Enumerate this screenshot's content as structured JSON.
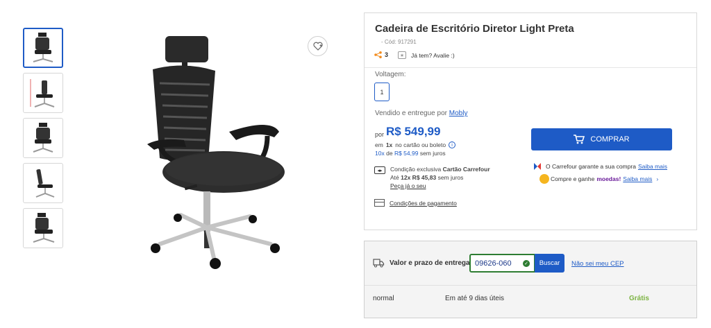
{
  "gallery": {
    "thumbnails": [
      "chair-front",
      "chair-side-dimensions",
      "chair-front-2",
      "chair-side",
      "chair-angle"
    ],
    "favorite_icon": "heart-plus-icon"
  },
  "product": {
    "title": "Cadeira de Escritório Diretor Light Preta",
    "sku": "- Cód: 917291",
    "share_count": "3",
    "review_prompt": "Já tem? Avalie :)",
    "voltage_label": "Voltagem:",
    "voltage_option": "1",
    "seller_prefix": "Vendido e entregue por",
    "seller_name": "Mobly",
    "price_prefix": "por",
    "price": "R$ 549,99",
    "install_em": "em",
    "install_1x": "1x",
    "install_1x_text": "no cartão ou boleto",
    "install_10x": "10x",
    "install_de": "de",
    "install_10x_value": "R$ 54,99",
    "install_10x_suffix": "sem juros",
    "carrefour_line1_prefix": "Condição exclusiva",
    "carrefour_line1_bold": "Cartão Carrefour",
    "carrefour_line2_prefix": "Até",
    "carrefour_line2_bold": "12x R$ 45,83",
    "carrefour_line2_suffix": "sem juros",
    "carrefour_link": "Peça já o seu",
    "payment_conditions": "Condições de pagamento",
    "buy_label": "COMPRAR",
    "guarantee_text": "O Carrefour garante a sua compra",
    "guarantee_link": "Saiba mais",
    "moedas_prefix": "Compre e ganhe",
    "moedas_bold": "moedas!",
    "moedas_link": "Saiba mais",
    "moedas_chevron": "›"
  },
  "shipping": {
    "label": "Valor e prazo de entrega",
    "cep_value": "09626-060",
    "search_label": "Buscar",
    "dont_know_cep": "Não sei meu CEP",
    "option": {
      "mode": "normal",
      "time": "Em até 9 dias úteis",
      "price": "Grátis"
    }
  },
  "colors": {
    "accent": "#1e5bc6",
    "success": "#2e7d32",
    "free": "#7cb342"
  }
}
